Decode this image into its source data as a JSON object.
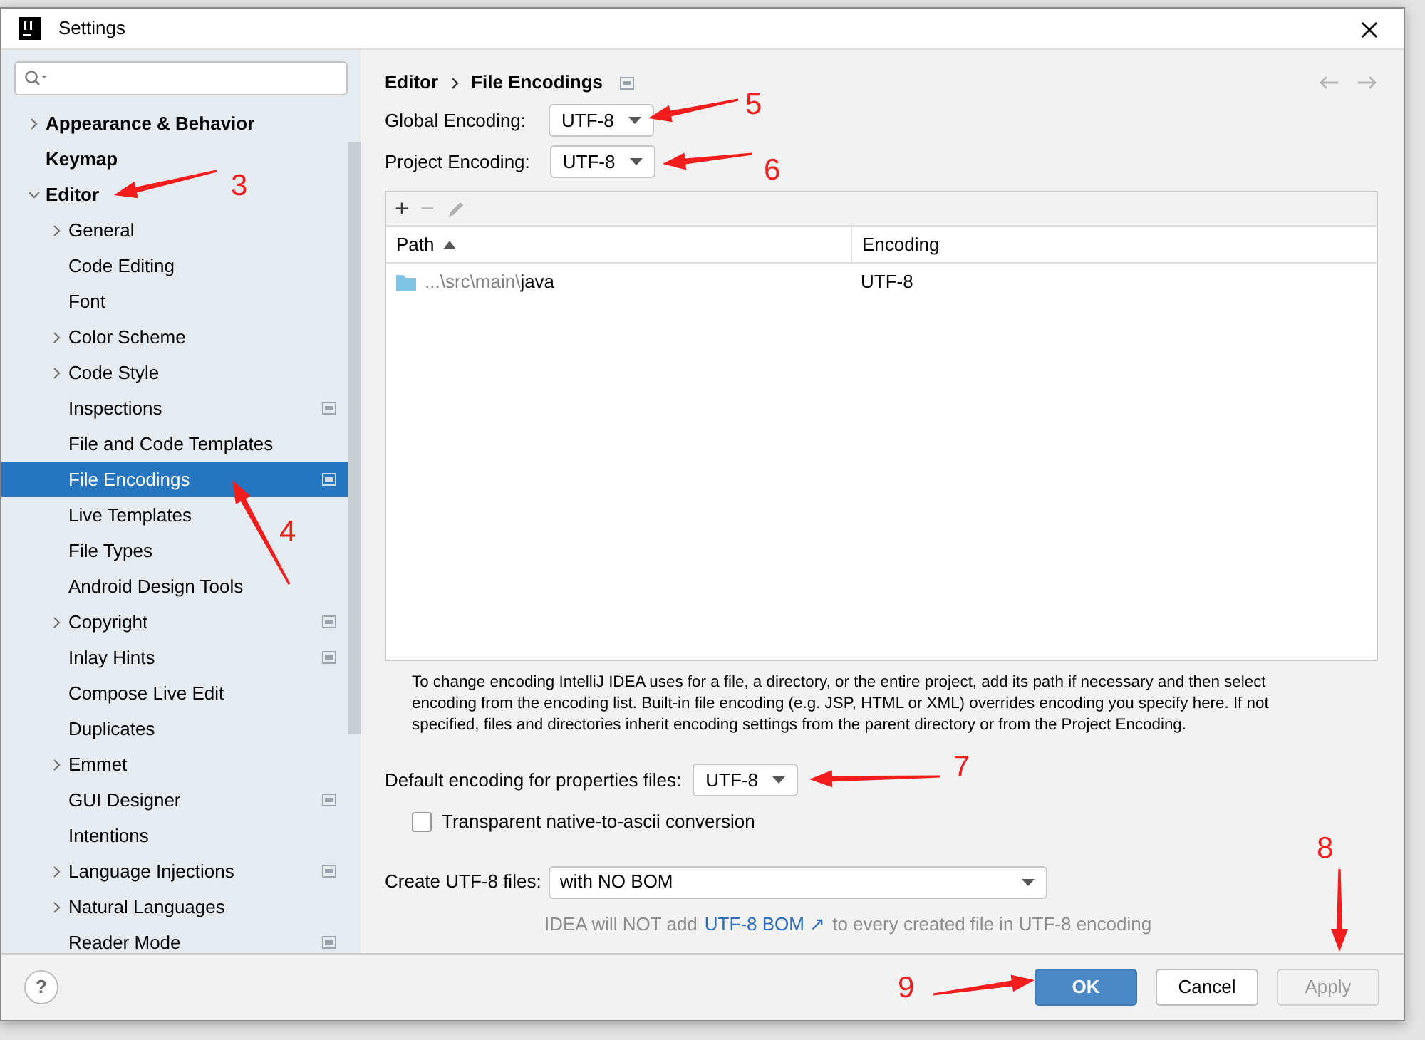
{
  "window": {
    "title": "Settings"
  },
  "sidebar": {
    "items": [
      {
        "label": "Appearance & Behavior",
        "expanded": false,
        "selected": false
      },
      {
        "label": "Keymap",
        "selected": false
      },
      {
        "label": "Editor",
        "expanded": true,
        "selected": false,
        "children": [
          {
            "label": "General",
            "expanded": false,
            "selected": false
          },
          {
            "label": "Code Editing",
            "selected": false
          },
          {
            "label": "Font",
            "selected": false
          },
          {
            "label": "Color Scheme",
            "expanded": false,
            "selected": false
          },
          {
            "label": "Code Style",
            "expanded": false,
            "selected": false
          },
          {
            "label": "Inspections",
            "project_scope": true,
            "selected": false
          },
          {
            "label": "File and Code Templates",
            "selected": false
          },
          {
            "label": "File Encodings",
            "project_scope": true,
            "selected": true
          },
          {
            "label": "Live Templates",
            "selected": false
          },
          {
            "label": "File Types",
            "selected": false
          },
          {
            "label": "Android Design Tools",
            "selected": false
          },
          {
            "label": "Copyright",
            "expanded": false,
            "project_scope": true,
            "selected": false
          },
          {
            "label": "Inlay Hints",
            "project_scope": true,
            "selected": false
          },
          {
            "label": "Compose Live Edit",
            "selected": false
          },
          {
            "label": "Duplicates",
            "selected": false
          },
          {
            "label": "Emmet",
            "expanded": false,
            "selected": false
          },
          {
            "label": "GUI Designer",
            "project_scope": true,
            "selected": false
          },
          {
            "label": "Intentions",
            "selected": false
          },
          {
            "label": "Language Injections",
            "expanded": false,
            "project_scope": true,
            "selected": false
          },
          {
            "label": "Natural Languages",
            "expanded": false,
            "selected": false
          },
          {
            "label": "Reader Mode",
            "project_scope": true,
            "selected": false
          }
        ]
      }
    ]
  },
  "breadcrumb": [
    "Editor",
    "File Encodings"
  ],
  "global_encoding": {
    "label": "Global Encoding:",
    "value": "UTF-8"
  },
  "project_encoding": {
    "label": "Project Encoding:",
    "value": "UTF-8"
  },
  "table": {
    "toolbar": [
      "+",
      "−"
    ],
    "columns": [
      "Path",
      "Encoding"
    ],
    "sort_ascending": true,
    "rows": [
      {
        "path_prefix": "...\\src\\main\\",
        "path_name": "java",
        "encoding": "UTF-8"
      }
    ]
  },
  "description": "To change encoding IntelliJ IDEA uses for a file, a directory, or the entire project, add its path if necessary and then select encoding from the encoding list. Built-in file encoding (e.g. JSP, HTML or XML) overrides encoding you specify here. If not specified, files and directories inherit encoding settings from the parent directory or from the Project Encoding.",
  "properties_encoding": {
    "label": "Default encoding for properties files:",
    "value": "UTF-8"
  },
  "transparent_conversion": {
    "label": "Transparent native-to-ascii conversion",
    "checked": false
  },
  "create_utf8": {
    "label": "Create UTF-8 files:",
    "value": "with NO BOM"
  },
  "hint": {
    "before": "IDEA will NOT add",
    "link": "UTF-8 BOM ↗",
    "after": "to every created file in UTF-8 encoding"
  },
  "help": "?",
  "buttons": [
    {
      "label": "OK",
      "kind": "primary",
      "disabled": false
    },
    {
      "label": "Cancel",
      "kind": "secondary",
      "disabled": false
    },
    {
      "label": "Apply",
      "kind": "secondary",
      "disabled": true
    }
  ],
  "annotations": [
    {
      "label": "3"
    },
    {
      "label": "4"
    },
    {
      "label": "5"
    },
    {
      "label": "6"
    },
    {
      "label": "7"
    },
    {
      "label": "8"
    },
    {
      "label": "9"
    }
  ]
}
